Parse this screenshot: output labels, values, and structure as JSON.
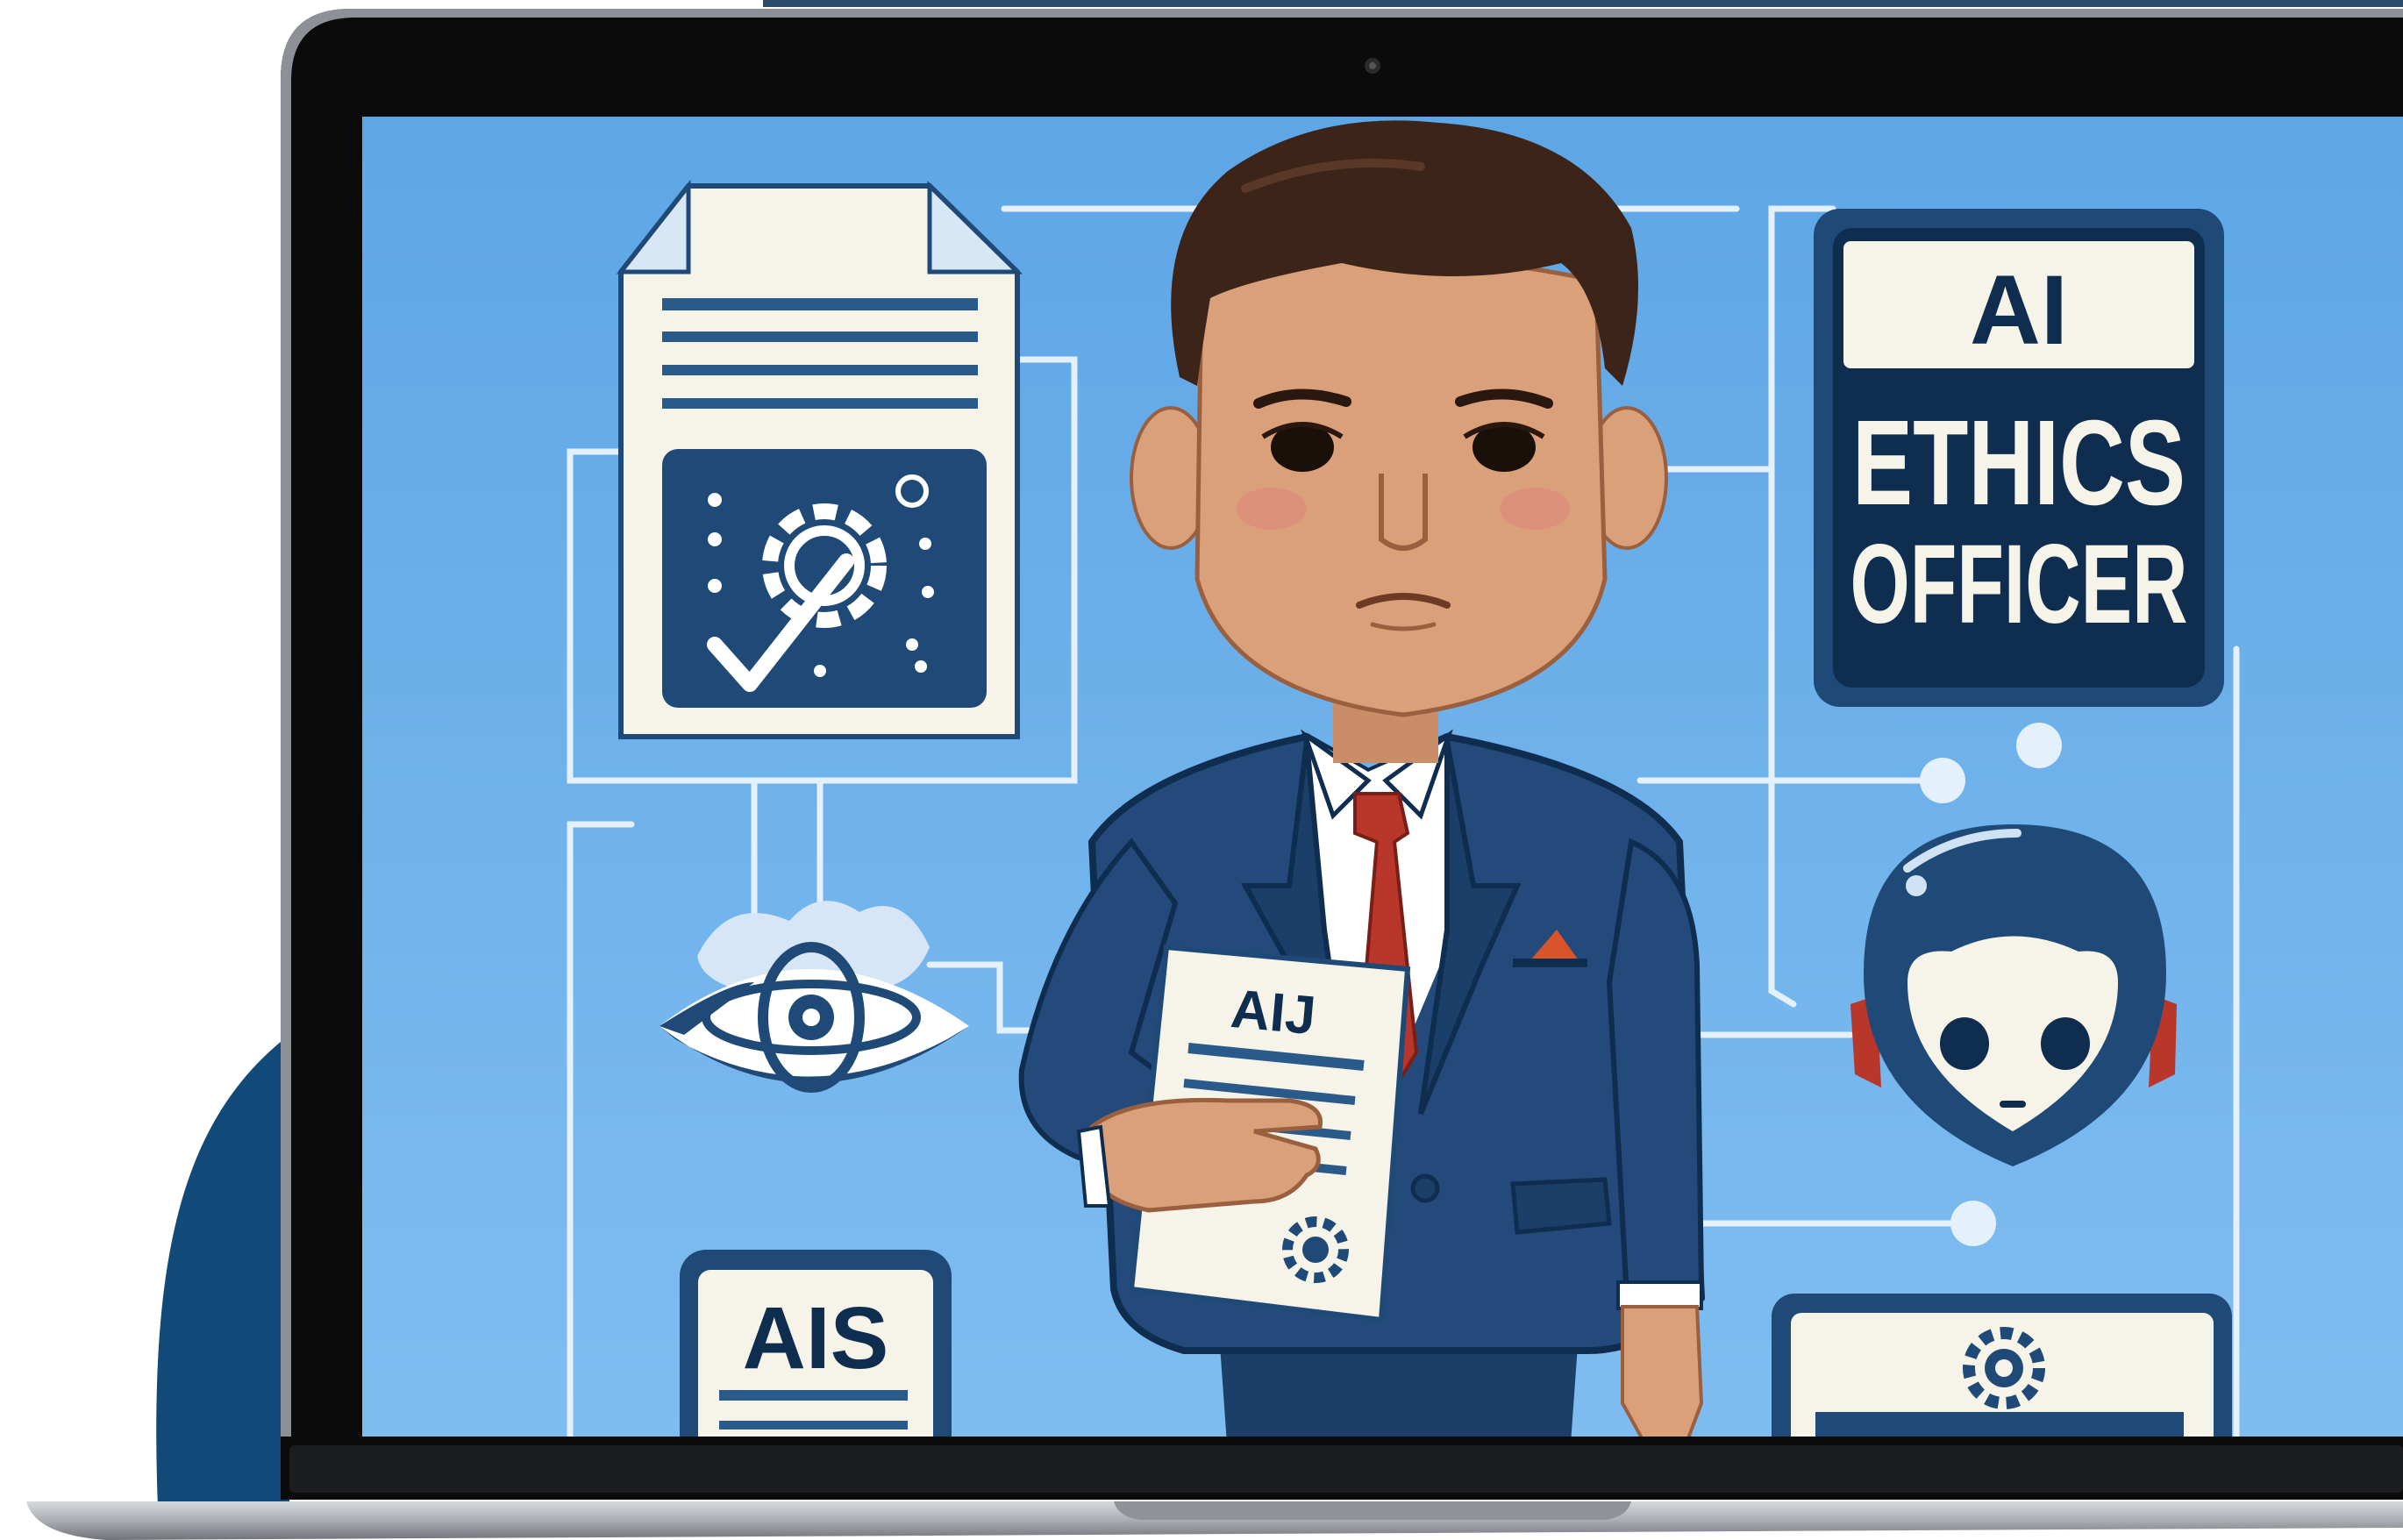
{
  "colors": {
    "screen_bg": "#6aaee8",
    "screen_bg_light": "#8cc4f0",
    "navy": "#1f4a78",
    "dark_navy": "#0f2d4f",
    "suit": "#234a7a",
    "tie": "#b8362a",
    "skin": "#d9a07a",
    "hair": "#3c2418",
    "paper": "#f6f3e8",
    "circuit": "#e8f2fb",
    "bezel": "#0a0a0a",
    "laptop_base": "#b5b8bd",
    "accent_blob": "#114a78"
  },
  "sign": {
    "line1": "AI",
    "line2": "ETHICS",
    "line3": "OFFICER"
  },
  "held_document": {
    "title": "AIJ"
  },
  "bottom_left_card": {
    "title": "AIS"
  },
  "icons": {
    "document": "document-icon",
    "gear_check": "gear-check-icon",
    "eye_emblem": "eye-emblem-icon",
    "robot_head": "robot-head-icon",
    "gear_badge": "gear-badge-icon",
    "camera": "webcam-icon"
  }
}
